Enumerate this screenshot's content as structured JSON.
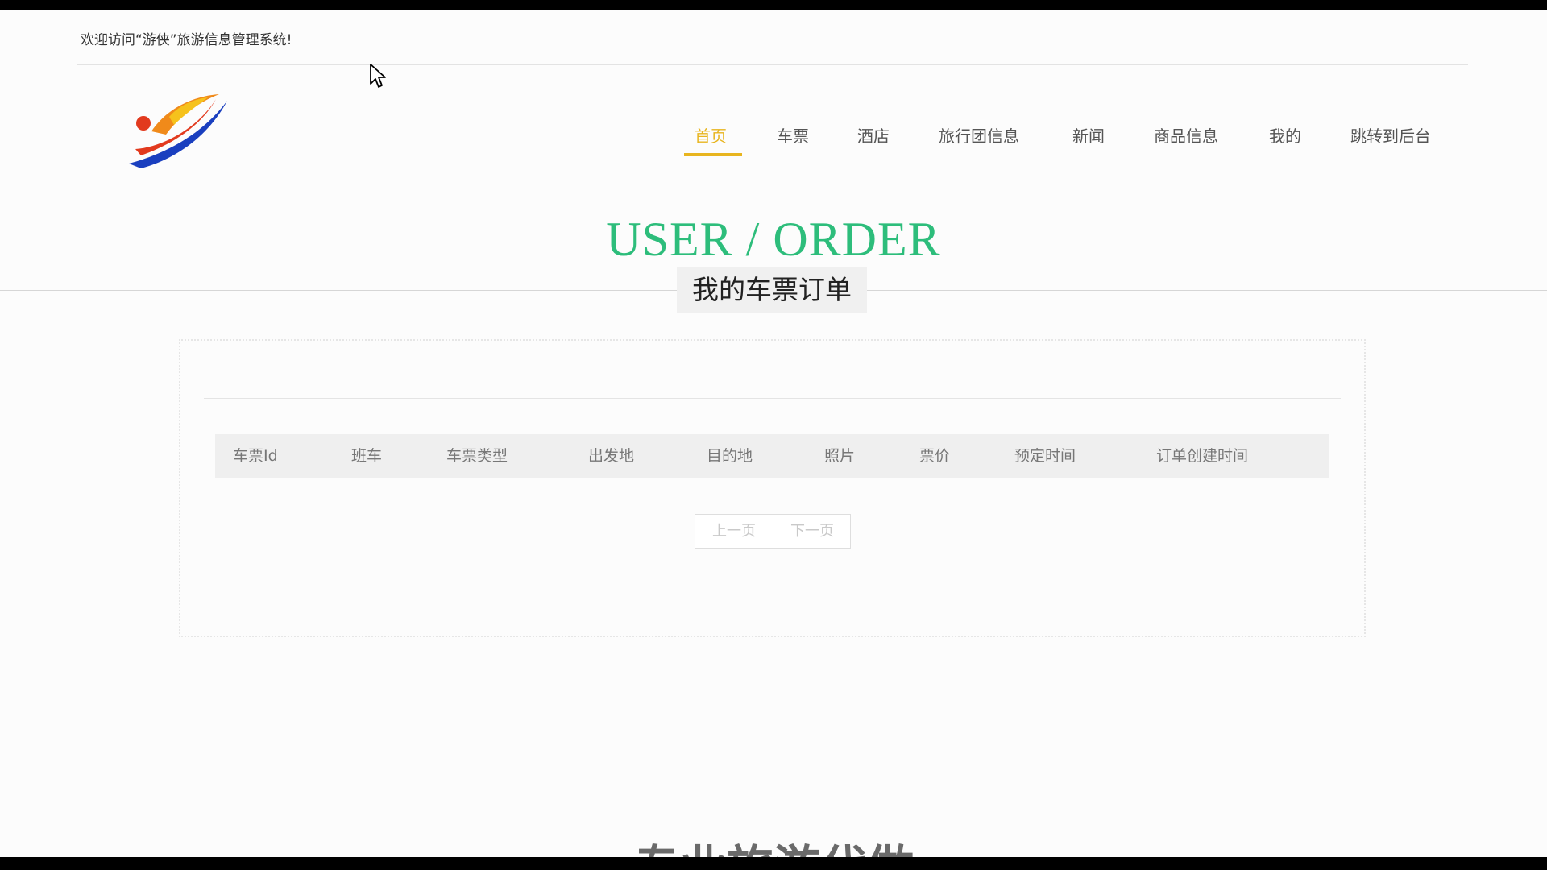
{
  "header": {
    "welcome": "欢迎访问“游侠”旅游信息管理系统!"
  },
  "nav": {
    "items": [
      {
        "label": "首页",
        "active": true
      },
      {
        "label": "车票"
      },
      {
        "label": "酒店"
      },
      {
        "label": "旅行团信息"
      },
      {
        "label": "新闻"
      },
      {
        "label": "商品信息"
      },
      {
        "label": "我的"
      },
      {
        "label": "跳转到后台"
      }
    ],
    "active_color": "#e8b51f"
  },
  "hero": {
    "title": "USER / ORDER",
    "subtitle": "我的车票订单",
    "title_color": "#2dbd7b"
  },
  "table": {
    "columns": [
      "车票Id",
      "班车",
      "车票类型",
      "出发地",
      "目的地",
      "照片",
      "票价",
      "预定时间",
      "订单创建时间"
    ],
    "rows": []
  },
  "pagination": {
    "prev": "上一页",
    "next": "下一页"
  },
  "footer_partial": {
    "text": "专业旅游代做"
  },
  "icons": {
    "logo": "travel-logo",
    "cursor": "mouse-pointer-icon"
  }
}
